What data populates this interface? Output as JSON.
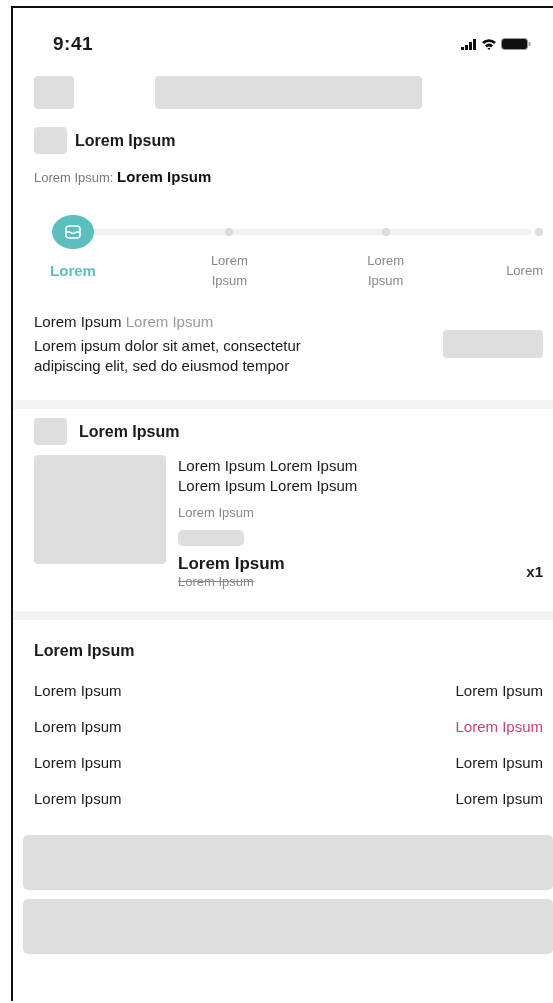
{
  "status_bar": {
    "time": "9:41"
  },
  "order": {
    "title": "Lorem Ipsum",
    "meta_label": "Lorem Ipsum:",
    "meta_value": "Lorem Ipsum"
  },
  "steps": [
    {
      "label": "Lorem",
      "selected": true
    },
    {
      "label": "Lorem Ipsum",
      "selected": false
    },
    {
      "label": "Lorem Ipsum",
      "selected": false
    },
    {
      "label": "Lorem",
      "selected": false
    }
  ],
  "status": {
    "title": "Lorem Ipsum",
    "subtitle": "Lorem Ipsum",
    "text": "Lorem ipsum dolor sit amet, consectetur adipiscing elit, sed do eiusmod tempor"
  },
  "shop": {
    "title": "Lorem Ipsum",
    "product": {
      "name": "Lorem Ipsum Lorem Ipsum Lorem Ipsum Lorem Ipsum",
      "variant": "Lorem Ipsum",
      "price": "Lorem Ipsum",
      "old_price": "Lorem Ipsum",
      "quantity": "x1"
    }
  },
  "summary": {
    "title": "Lorem Ipsum",
    "rows": [
      {
        "label": "Lorem Ipsum",
        "value": "Lorem Ipsum",
        "color": "#1a1a1a"
      },
      {
        "label": "Lorem Ipsum",
        "value": "Lorem Ipsum",
        "color": "#d0406c"
      },
      {
        "label": "Lorem Ipsum",
        "value": "Lorem Ipsum",
        "color": "#1a1a1a"
      },
      {
        "label": "Lorem Ipsum",
        "value": "Lorem Ipsum",
        "color": "#1a1a1a"
      }
    ]
  }
}
